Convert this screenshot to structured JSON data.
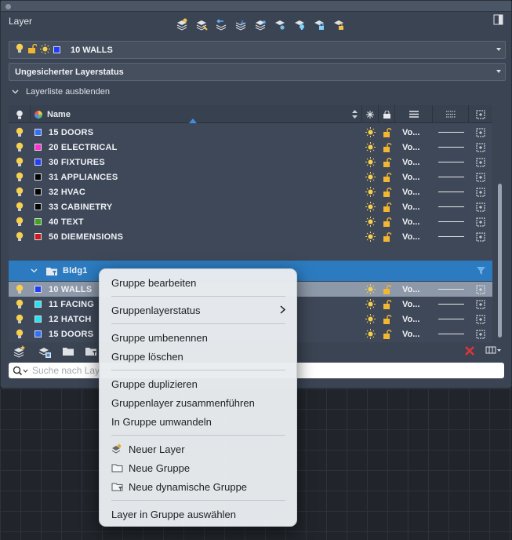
{
  "panel": {
    "title": "Layer"
  },
  "current_layer": {
    "name": "10 WALLS",
    "color": "#1f3cff"
  },
  "layer_state": {
    "value": "Ungesicherter Layerstatus"
  },
  "layer_list_toggle": {
    "label": "Layerliste ausblenden"
  },
  "table": {
    "headers": {
      "name": "Name"
    },
    "layers": [
      {
        "name": "15 DOORS",
        "color": "#2f6fff",
        "linetype": "Vo..."
      },
      {
        "name": "20 ELECTRICAL",
        "color": "#ff2fd0",
        "linetype": "Vo..."
      },
      {
        "name": "30 FIXTURES",
        "color": "#1f3cff",
        "linetype": "Vo..."
      },
      {
        "name": "31 APPLIANCES",
        "color": "#000000",
        "linetype": "Vo..."
      },
      {
        "name": "32 HVAC",
        "color": "#000000",
        "linetype": "Vo..."
      },
      {
        "name": "33 CABINETRY",
        "color": "#000000",
        "linetype": "Vo..."
      },
      {
        "name": "40 TEXT",
        "color": "#3ea31a",
        "linetype": "Vo..."
      },
      {
        "name": "50 DIEMENSIONS",
        "color": "#d01818",
        "linetype": "Vo..."
      }
    ],
    "group": {
      "name": "Bldg1"
    },
    "group_layers": [
      {
        "name": "10 WALLS",
        "color": "#1f3cff",
        "linetype": "Vo...",
        "selected": true
      },
      {
        "name": "11 FACING",
        "color": "#22e4f2",
        "linetype": "Vo...",
        "selected": false
      },
      {
        "name": "12 HATCH",
        "color": "#22e4f2",
        "linetype": "Vo...",
        "selected": false
      },
      {
        "name": "15 DOORS",
        "color": "#2f6fff",
        "linetype": "Vo...",
        "selected": false
      }
    ]
  },
  "search": {
    "placeholder": "Suche nach Layer"
  },
  "context_menu": {
    "items": [
      {
        "label": "Gruppe bearbeiten"
      },
      {
        "label": "Gruppenlayerstatus"
      },
      {
        "label": "Gruppe umbenennen"
      },
      {
        "label": "Gruppe löschen"
      },
      {
        "label": "Gruppe duplizieren"
      },
      {
        "label": "Gruppenlayer zusammenführen"
      },
      {
        "label": "In Gruppe umwandeln"
      },
      {
        "label": "Neuer Layer",
        "icon": "new-layer-icon"
      },
      {
        "label": "Neue Gruppe",
        "icon": "folder-icon"
      },
      {
        "label": "Neue dynamische Gruppe",
        "icon": "dynamic-folder-icon"
      },
      {
        "label": "Layer in Gruppe auswählen"
      }
    ]
  },
  "colors": {
    "accent": "#2c7bc0",
    "panel": "#3b4453",
    "delete": "#e0333a"
  }
}
